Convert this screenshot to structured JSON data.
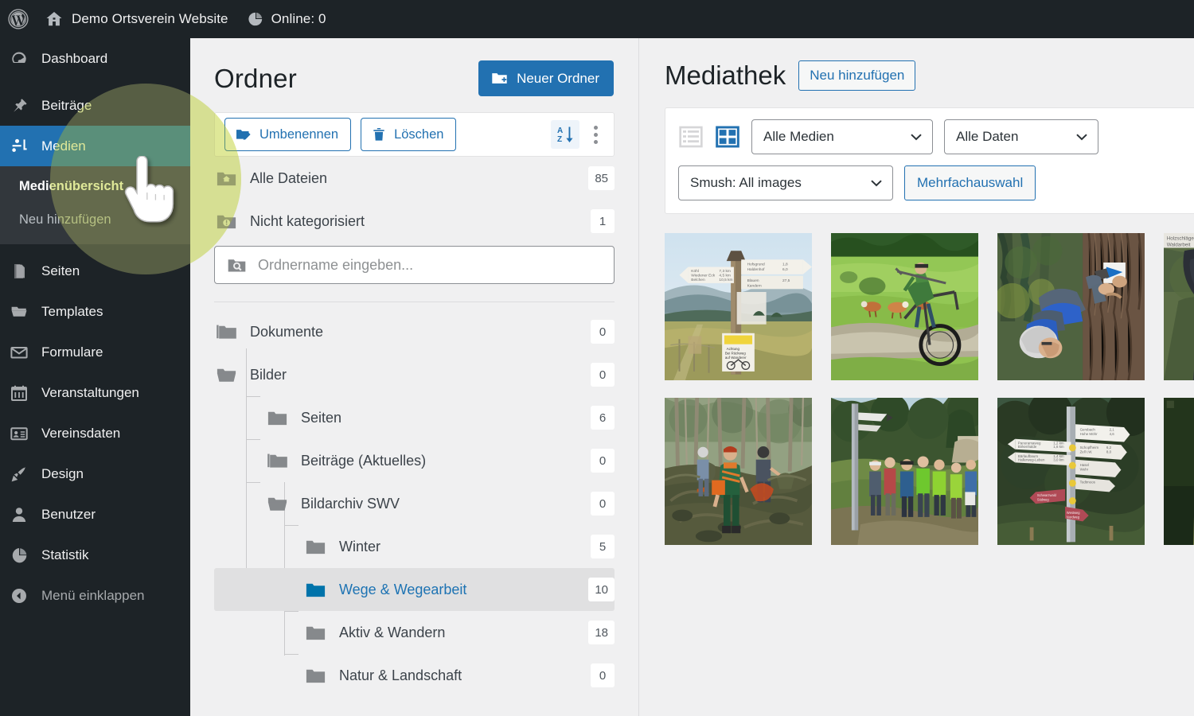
{
  "adminbar": {
    "site_title": "Demo Ortsverein Website",
    "online_label": "Online: 0",
    "wp_icon": "wordpress-logo-icon",
    "home_icon": "home-icon",
    "stats_icon": "pie-chart-icon"
  },
  "sidebar": {
    "items": [
      {
        "label": "Dashboard",
        "icon": "dashboard-icon",
        "active": false
      },
      {
        "label": "Beiträge",
        "icon": "pin-icon",
        "active": false
      },
      {
        "label": "Medien",
        "icon": "media-icon",
        "active": true
      },
      {
        "label": "Seiten",
        "icon": "pages-icon",
        "active": false
      },
      {
        "label": "Templates",
        "icon": "folder-open-icon",
        "active": false
      },
      {
        "label": "Formulare",
        "icon": "envelope-icon",
        "active": false
      },
      {
        "label": "Veranstaltungen",
        "icon": "calendar-icon",
        "active": false
      },
      {
        "label": "Vereinsdaten",
        "icon": "id-card-icon",
        "active": false
      },
      {
        "label": "Design",
        "icon": "paintbrush-icon",
        "active": false
      },
      {
        "label": "Benutzer",
        "icon": "user-icon",
        "active": false
      },
      {
        "label": "Statistik",
        "icon": "pie-chart-icon",
        "active": false
      }
    ],
    "submenu": [
      {
        "label": "Medienübersicht",
        "current": true
      },
      {
        "label": "Neu hinzufügen",
        "current": false
      }
    ],
    "collapse_label": "Menü einklappen",
    "collapse_icon": "chevron-left-circle-icon",
    "active_color": "#2271b1"
  },
  "folders": {
    "title": "Ordner",
    "new_folder_label": "Neuer Ordner",
    "new_folder_icon": "folder-plus-icon",
    "toolbar": {
      "rename_label": "Umbenennen",
      "rename_icon": "folder-edit-icon",
      "delete_label": "Löschen",
      "delete_icon": "trash-icon",
      "sort_icon": "sort-az-icon",
      "more_icon": "more-vertical-icon"
    },
    "search_placeholder": "Ordnername eingeben...",
    "search_value": "",
    "search_icon": "folder-search-icon",
    "special": [
      {
        "label": "Alle Dateien",
        "count": "85",
        "icon": "folder-home-icon"
      },
      {
        "label": "Nicht kategorisiert",
        "count": "1",
        "icon": "folder-alert-icon"
      }
    ],
    "tree": [
      {
        "label": "Dokumente",
        "count": "0",
        "depth": 0,
        "icon": "folder-stack-icon",
        "selected": false
      },
      {
        "label": "Bilder",
        "count": "0",
        "depth": 0,
        "icon": "folder-open-icon",
        "selected": false
      },
      {
        "label": "Seiten",
        "count": "6",
        "depth": 1,
        "icon": "folder-icon",
        "selected": false
      },
      {
        "label": "Beiträge (Aktuelles)",
        "count": "0",
        "depth": 1,
        "icon": "folder-stack-icon",
        "selected": false
      },
      {
        "label": "Bildarchiv SWV",
        "count": "0",
        "depth": 1,
        "icon": "folder-open-icon",
        "selected": false
      },
      {
        "label": "Winter",
        "count": "5",
        "depth": 2,
        "icon": "folder-icon",
        "selected": false
      },
      {
        "label": "Wege & Wegearbeit",
        "count": "10",
        "depth": 2,
        "icon": "folder-icon",
        "selected": true
      },
      {
        "label": "Aktiv & Wandern",
        "count": "18",
        "depth": 2,
        "icon": "folder-icon",
        "selected": false
      },
      {
        "label": "Natur & Landschaft",
        "count": "0",
        "depth": 2,
        "icon": "folder-icon",
        "selected": false
      }
    ],
    "selected_color": "#1d73b3"
  },
  "media": {
    "title": "Mediathek",
    "add_new_label": "Neu hinzufügen",
    "view_list_icon": "list-view-icon",
    "view_grid_icon": "grid-view-icon",
    "view_mode": "grid",
    "filter_type": "Alle Medien",
    "filter_date": "Alle Daten",
    "filter_smush": "Smush: All images",
    "multiselect_label": "Mehrfachauswahl",
    "chevron_icon": "chevron-down-icon",
    "items": [
      {
        "alt": "Wegweiser Schild auf Bergwiese mit Fahrradsymbol",
        "kind": "signpost-meadow"
      },
      {
        "alt": "Radfahrer mit Material auf Weg neben Kuhweide",
        "kind": "cyclist-pasture"
      },
      {
        "alt": "Mann befestigt blaue Wegmarkierung an Baum",
        "kind": "marking-tree"
      },
      {
        "alt": "Person in dunkler Jacke im Wald",
        "kind": "person-forest"
      },
      {
        "alt": "Wegearbeiter mit Motorsäge im Wald",
        "kind": "forest-work"
      },
      {
        "alt": "Wandergruppe auf Waldweg bei Wegweiser",
        "kind": "hiking-group"
      },
      {
        "alt": "Metallwegweiser mit vielen Schildern im Wald",
        "kind": "signpost-forest"
      },
      {
        "alt": "Waldrand mit Wiese",
        "kind": "forest-edge"
      }
    ]
  },
  "overlay": {
    "highlight_color": "#c7d64a",
    "cursor_icon": "pointing-hand-cursor"
  }
}
